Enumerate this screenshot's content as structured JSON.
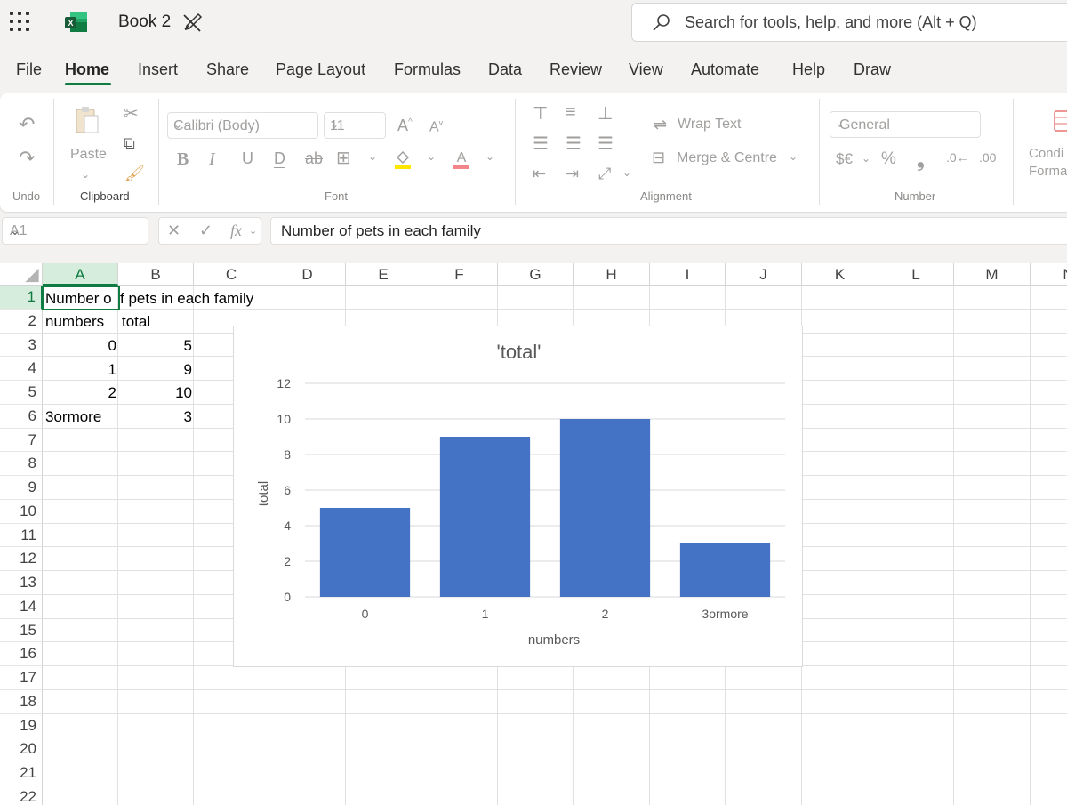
{
  "app": {
    "doc_title": "Book 2",
    "search_placeholder": "Search for tools, help, and more (Alt + Q)"
  },
  "menu": {
    "tabs": [
      "File",
      "Home",
      "Insert",
      "Share",
      "Page Layout",
      "Formulas",
      "Data",
      "Review",
      "View",
      "Automate",
      "Help",
      "Draw"
    ],
    "active": "Home"
  },
  "ribbon": {
    "undo_label": "Undo",
    "clipboard_label": "Clipboard",
    "paste_label": "Paste",
    "font_label": "Font",
    "font_name": "Calibri (Body)",
    "font_size": "11",
    "alignment_label": "Alignment",
    "wrap_text": "Wrap Text",
    "merge_centre": "Merge & Centre",
    "number_label": "Number",
    "number_format": "General",
    "currency_symbol": "$€",
    "percent_symbol": "%",
    "conditional_1": "Condi",
    "conditional_2": "Forma"
  },
  "formula_bar": {
    "name_box": "A1",
    "formula": "Number of pets in each family"
  },
  "sheet": {
    "columns": [
      "A",
      "B",
      "C",
      "D",
      "E",
      "F",
      "G",
      "H",
      "I",
      "J",
      "K",
      "L",
      "M",
      "N"
    ],
    "rows": [
      "1",
      "2",
      "3",
      "4",
      "5",
      "6",
      "7",
      "8",
      "9",
      "10",
      "11",
      "12",
      "13",
      "14",
      "15",
      "16",
      "17",
      "18",
      "19",
      "20",
      "21",
      "22"
    ],
    "a1": "Number of pets in each family",
    "a1_visible": "Number o",
    "b1_visible": "f pets in each family",
    "a2": "numbers",
    "b2": "total",
    "a3": "0",
    "b3": "5",
    "a4": "1",
    "b4": "9",
    "a5": "2",
    "b5": "10",
    "a6": "3ormore",
    "b6": "3"
  },
  "chart_data": {
    "type": "bar",
    "title": "'total'",
    "xlabel": "numbers",
    "ylabel": "total",
    "categories": [
      "0",
      "1",
      "2",
      "3ormore"
    ],
    "values": [
      5,
      9,
      10,
      3
    ],
    "ylim": [
      0,
      12
    ],
    "yticks": [
      0,
      2,
      4,
      6,
      8,
      10,
      12
    ],
    "grid": true,
    "bar_color": "#4472c4"
  },
  "colors": {
    "accent": "#107c41",
    "selection_fill": "#d6ecdc"
  }
}
